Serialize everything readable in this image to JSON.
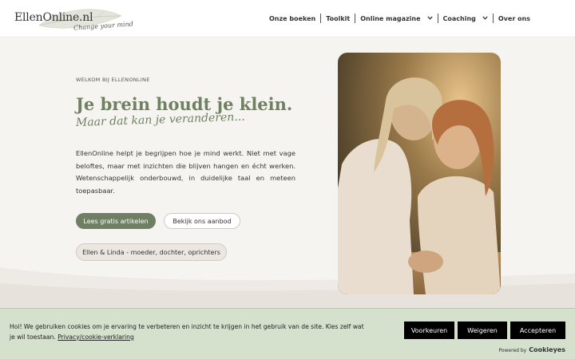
{
  "header": {
    "logo_text": "EllenOnline.nl",
    "logo_tagline": "Change your mind",
    "nav": [
      {
        "label": "Onze boeken",
        "has_dropdown": false
      },
      {
        "label": "Toolkit",
        "has_dropdown": false
      },
      {
        "label": "Online magazine",
        "has_dropdown": true
      },
      {
        "label": "Coaching",
        "has_dropdown": true
      },
      {
        "label": "Over ons",
        "has_dropdown": false
      }
    ]
  },
  "hero": {
    "eyebrow": "WELKOM BIJ ELLENONLINE",
    "headline": "Je brein houdt je klein.",
    "subheadline": "Maar dat kan je veranderen...",
    "body": "EllenOnline helpt je begrijpen hoe je mind werkt. Niet met vage beloftes, maar met inzichten die blijven hangen en écht werken. Wetenschappelijk onderbouwd, in duidelijke taal en meteen toepasbaar.",
    "primary_button": "Lees gratis artikelen",
    "secondary_button": "Bekijk ons aanbod",
    "founders_pill": "Ellen & Linda - moeder, dochter, oprichters"
  },
  "cookie_banner": {
    "text": "Hoi! We gebruiken cookies om je ervaring te verbeteren en inzicht te krijgen in het gebruik van de site. Kies zelf wat je wil toestaan.",
    "link_text": "Privacy/cookie-verklaring",
    "preferences_button": "Voorkeuren",
    "refuse_button": "Weigeren",
    "accept_button": "Accepteren",
    "powered_by_prefix": "Powered by",
    "powered_by_brand": "Cookieyes"
  },
  "colors": {
    "accent_green": "#6f8161",
    "page_background": "#f6f4f1",
    "cookie_background": "#d5e0cd",
    "button_dark": "#000000"
  },
  "icons": {
    "nav_dropdown": "chevron-down-icon",
    "logo_decoration": "leaf-icon"
  }
}
